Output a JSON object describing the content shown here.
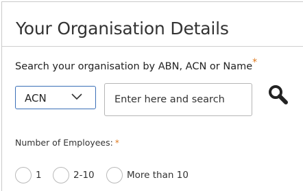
{
  "section": {
    "title": "Your Organisation Details"
  },
  "search": {
    "label": "Search your organisation by ABN, ACN or Name",
    "required_marker": "*",
    "type_selected": "ACN",
    "placeholder": "Enter here and search",
    "button_icon": "search-icon"
  },
  "employees": {
    "label": "Number of Employees:",
    "required_marker": "*",
    "options": [
      {
        "label": "1",
        "selected": false
      },
      {
        "label": "2-10",
        "selected": false
      },
      {
        "label": "More than 10",
        "selected": false
      }
    ]
  },
  "colors": {
    "required_star": "#e07a1f",
    "select_border": "#3a6fb7",
    "input_border": "#b5b5b5"
  }
}
